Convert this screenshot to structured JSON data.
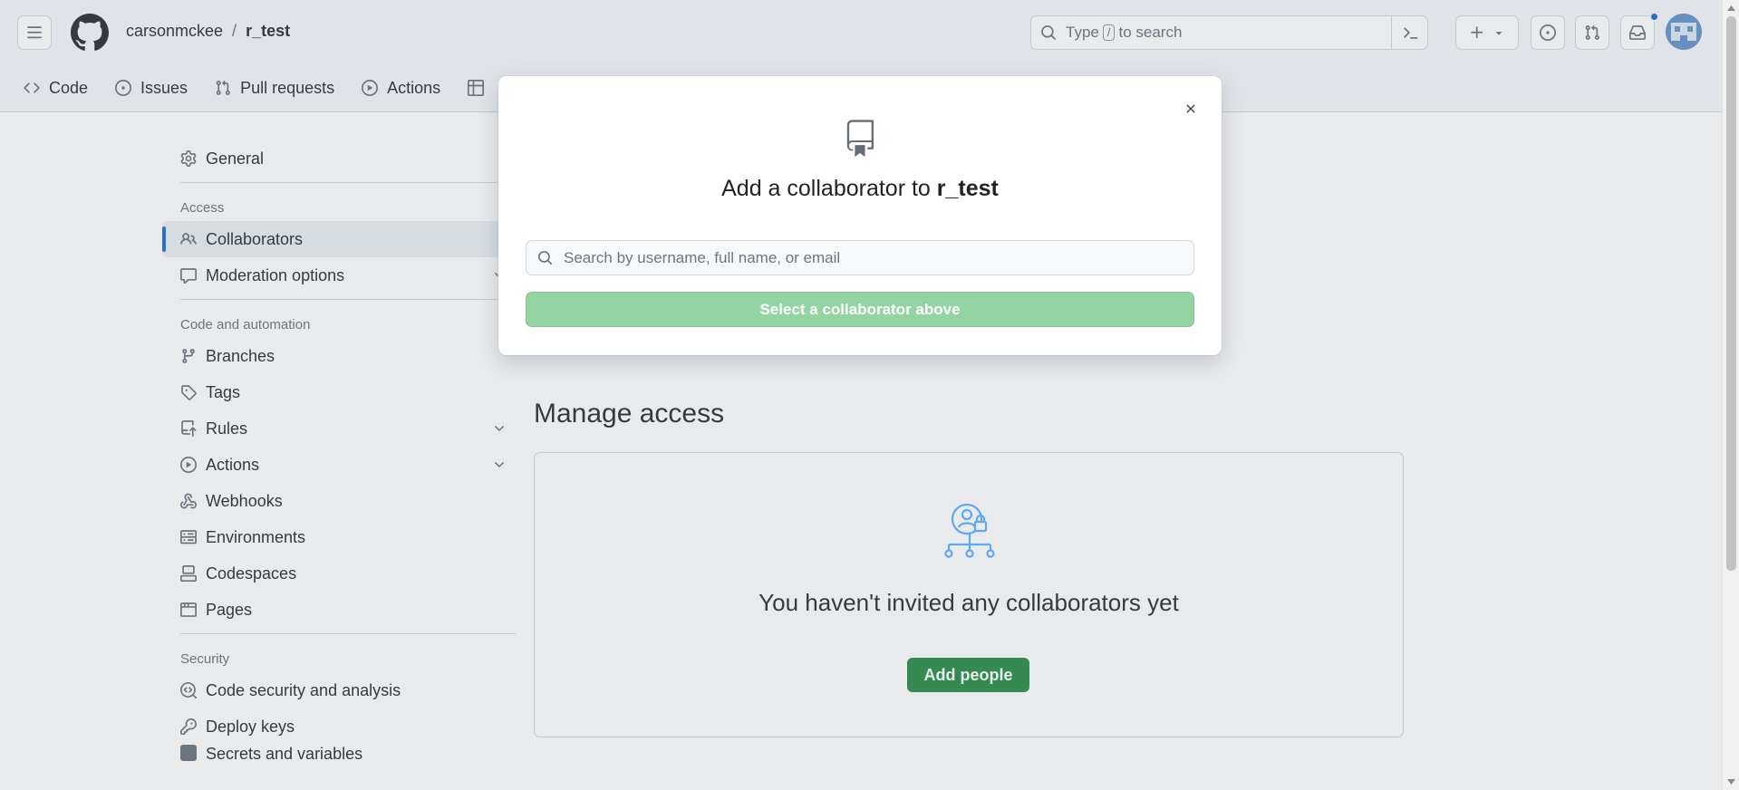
{
  "header": {
    "owner": "carsonmckee",
    "separator": "/",
    "repo": "r_test",
    "search_prefix": "Type",
    "search_key": "/",
    "search_suffix": "to search",
    "tabs": [
      {
        "label": "Code",
        "icon": "code-icon"
      },
      {
        "label": "Issues",
        "icon": "issue-opened-icon"
      },
      {
        "label": "Pull requests",
        "icon": "git-pull-request-icon"
      },
      {
        "label": "Actions",
        "icon": "play-icon"
      },
      {
        "label": "",
        "icon": "table-icon"
      }
    ]
  },
  "sidebar": {
    "general": "General",
    "access_heading": "Access",
    "collaborators": "Collaborators",
    "moderation": "Moderation options",
    "code_heading": "Code and automation",
    "branches": "Branches",
    "tags": "Tags",
    "rules": "Rules",
    "actions": "Actions",
    "webhooks": "Webhooks",
    "environments": "Environments",
    "codespaces": "Codespaces",
    "pages": "Pages",
    "security_heading": "Security",
    "code_security": "Code security and analysis",
    "deploy_keys": "Deploy keys",
    "secrets": "Secrets and variables"
  },
  "main": {
    "manage_title": "Manage access",
    "blank_text": "You haven't invited any collaborators yet",
    "add_people": "Add people"
  },
  "dialog": {
    "title_prefix": "Add a collaborator to",
    "title_repo": "r_test",
    "search_placeholder": "Search by username, full name, or email",
    "submit_label": "Select a collaborator above"
  },
  "colors": {
    "accent": "#0969da",
    "primary_button": "#1f883d",
    "disabled_button": "#94d3a2"
  }
}
